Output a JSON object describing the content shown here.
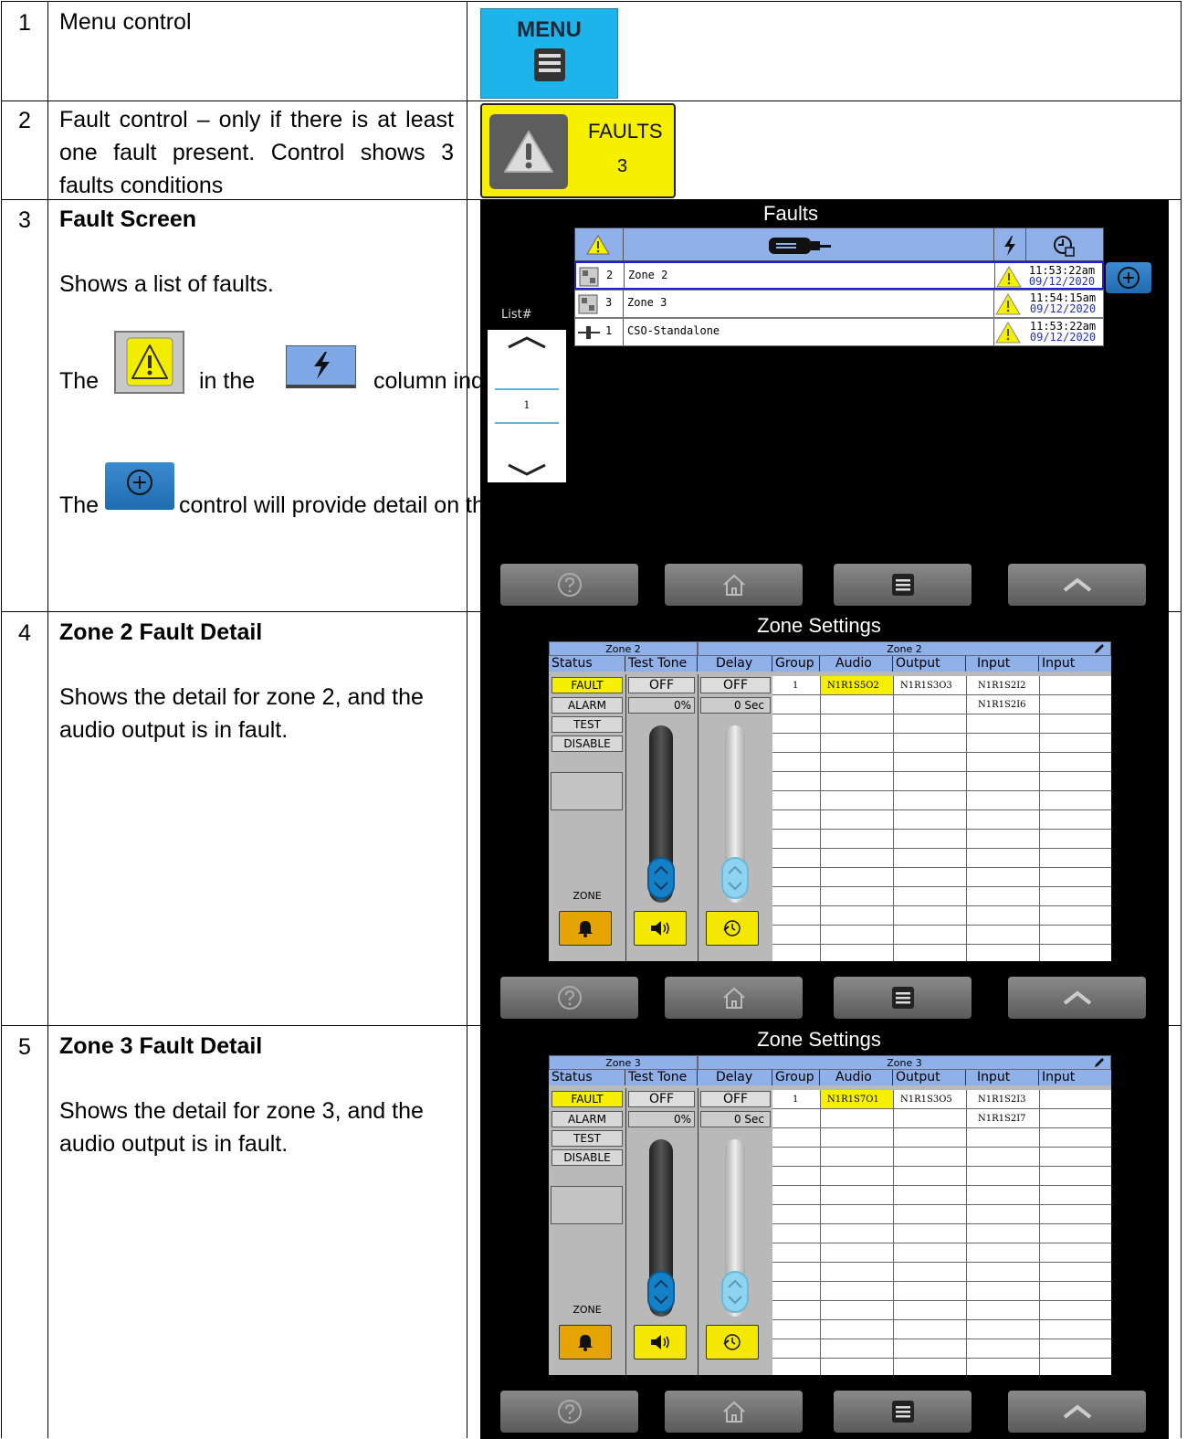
{
  "rows": [
    {
      "num": "1",
      "text": "Menu control"
    },
    {
      "num": "2",
      "text": "Fault control – only if there is at least one fault present. Control shows 3 faults conditions"
    },
    {
      "num": "3",
      "title": "Fault Screen",
      "p1": "Shows a list of faults.",
      "p2a": "The",
      "p2b": "in the",
      "p2c": "column indicates a fault.",
      "p3a": "The",
      "p3b": "control will provide detail on the individual fault."
    },
    {
      "num": "4",
      "title": "Zone 2 Fault Detail",
      "p1": "Shows the detail for zone 2, and the audio output is in fault."
    },
    {
      "num": "5",
      "title": "Zone 3 Fault Detail",
      "p1": "Shows the detail for zone 3, and the audio output is in fault."
    }
  ],
  "menu_button": {
    "label": "MENU"
  },
  "faults_button": {
    "label": "FAULTS",
    "count": "3"
  },
  "faults_screen": {
    "title": "Faults",
    "list_label": "List#",
    "page": "1",
    "rows": [
      {
        "num": "2",
        "name": "Zone 2",
        "time": "11:53:22am",
        "date": "09/12/2020"
      },
      {
        "num": "3",
        "name": "Zone 3",
        "time": "11:54:15am",
        "date": "09/12/2020"
      },
      {
        "num": "1",
        "name": "CSO-Standalone",
        "time": "11:53:22am",
        "date": "09/12/2020"
      }
    ]
  },
  "zone_screens": [
    {
      "title": "Zone Settings",
      "zone_left": "Zone 2",
      "zone_right": "Zone 2",
      "cols": [
        "Status",
        "Test Tone",
        "Delay",
        "Group",
        "Audio",
        "Output",
        "Input",
        "Input"
      ],
      "status": [
        "FAULT",
        "ALARM",
        "TEST",
        "DISABLE"
      ],
      "tone": "OFF",
      "tone_pct": "0%",
      "delay": "OFF",
      "delay_sec": "0 Sec",
      "group": "1",
      "audio": "N1R1S5O2",
      "output": "N1R1S3O3",
      "input1": "N1R1S2I2",
      "input2": "N1R1S2I6",
      "zone_label": "ZONE"
    },
    {
      "title": "Zone Settings",
      "zone_left": "Zone 3",
      "zone_right": "Zone 3",
      "cols": [
        "Status",
        "Test Tone",
        "Delay",
        "Group",
        "Audio",
        "Output",
        "Input",
        "Input"
      ],
      "status": [
        "FAULT",
        "ALARM",
        "TEST",
        "DISABLE"
      ],
      "tone": "OFF",
      "tone_pct": "0%",
      "delay": "OFF",
      "delay_sec": "0 Sec",
      "group": "1",
      "audio": "N1R1S7O1",
      "output": "N1R1S3O5",
      "input1": "N1R1S2I3",
      "input2": "N1R1S2I7",
      "zone_label": "ZONE"
    }
  ]
}
